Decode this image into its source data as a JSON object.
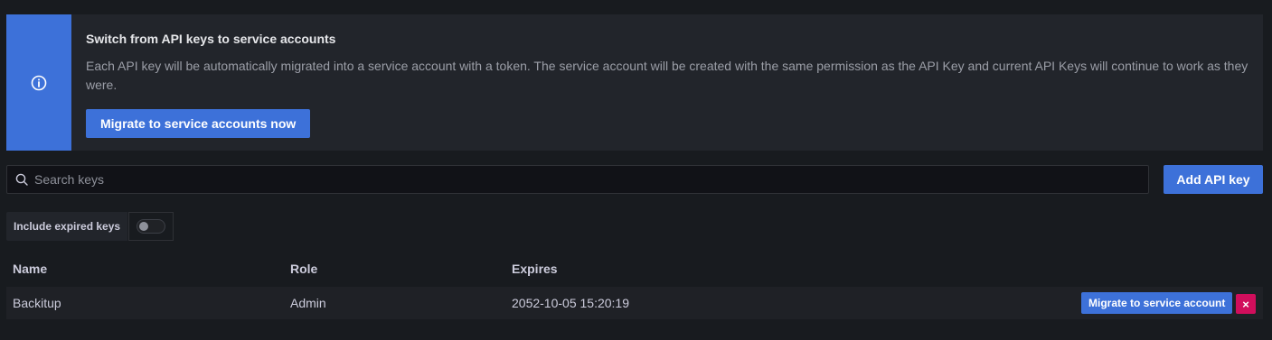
{
  "alert": {
    "icon": "info-circle-icon",
    "title": "Switch from API keys to service accounts",
    "text": "Each API key will be automatically migrated into a service account with a token. The service account will be created with the same permission as the API Key and current API Keys will continue to work as they were.",
    "button_label": "Migrate to service accounts now"
  },
  "search": {
    "placeholder": "Search keys",
    "value": ""
  },
  "add_button_label": "Add API key",
  "toggle": {
    "label": "Include expired keys",
    "checked": false
  },
  "table": {
    "headers": {
      "name": "Name",
      "role": "Role",
      "expires": "Expires"
    },
    "rows": [
      {
        "name": "Backitup",
        "role": "Admin",
        "expires": "2052-10-05 15:20:19",
        "migrate_label": "Migrate to service account",
        "delete_label": "×"
      }
    ]
  },
  "colors": {
    "primary": "#3d71d9",
    "danger": "#d10e5c",
    "background": "#181b1f"
  }
}
